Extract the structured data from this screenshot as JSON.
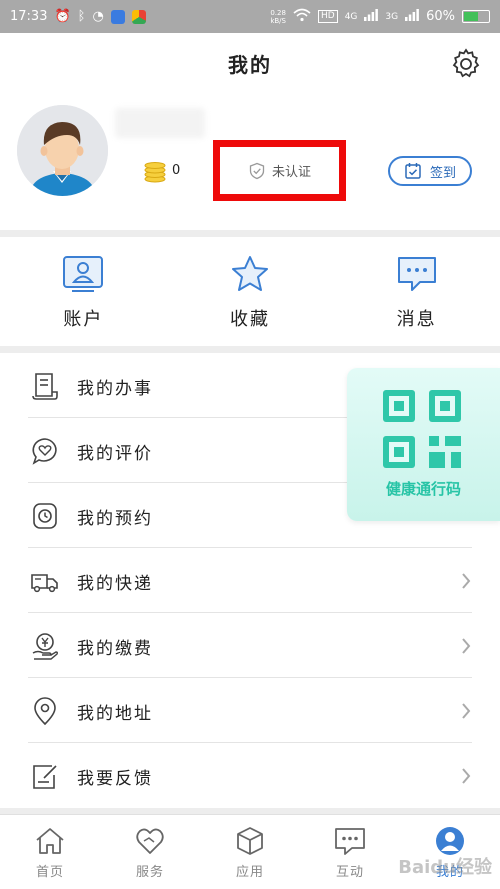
{
  "status_bar": {
    "time": "17:33",
    "net_speed_value": "0.28",
    "net_speed_unit": "kB/S",
    "hd_badge": "HD",
    "signal1": "4G",
    "signal2": "3G",
    "battery": "60%",
    "battery_level": 0.6,
    "icons": [
      "alarm-icon",
      "bluetooth-icon",
      "qq-icon",
      "security-app-icon",
      "browser-app-icon",
      "wifi-icon",
      "signal-icon",
      "battery-icon"
    ]
  },
  "header": {
    "title": "我的",
    "settings_icon": "gear-icon"
  },
  "profile": {
    "avatar": "avatar-icon",
    "coin_count": "0",
    "verify_label": "未认证",
    "signin_label": "签到"
  },
  "quick_actions": [
    {
      "label": "账户",
      "icon": "account-icon"
    },
    {
      "label": "收藏",
      "icon": "star-icon"
    },
    {
      "label": "消息",
      "icon": "message-icon"
    }
  ],
  "menu": [
    {
      "label": "我的办事",
      "icon": "document-icon"
    },
    {
      "label": "我的评价",
      "icon": "heart-chat-icon"
    },
    {
      "label": "我的预约",
      "icon": "clock-icon"
    },
    {
      "label": "我的快递",
      "icon": "truck-icon"
    },
    {
      "label": "我的缴费",
      "icon": "payment-icon"
    },
    {
      "label": "我的地址",
      "icon": "location-pin-icon"
    },
    {
      "label": "我要反馈",
      "icon": "feedback-icon"
    }
  ],
  "health_card": {
    "label": "健康通行码",
    "icon": "qr-code-icon"
  },
  "tabbar": [
    {
      "label": "首页",
      "icon": "home-icon",
      "active": false
    },
    {
      "label": "服务",
      "icon": "heart-hand-icon",
      "active": false
    },
    {
      "label": "应用",
      "icon": "cube-icon",
      "active": false
    },
    {
      "label": "互动",
      "icon": "chat-icon",
      "active": false
    },
    {
      "label": "我的",
      "icon": "person-icon",
      "active": true
    }
  ],
  "watermark": "Baidu经验",
  "colors": {
    "accent": "#3b7fd3",
    "highlight_border": "#ee0a0a",
    "health_green": "#27c4a6",
    "status_bar": "#a9a9a9"
  }
}
